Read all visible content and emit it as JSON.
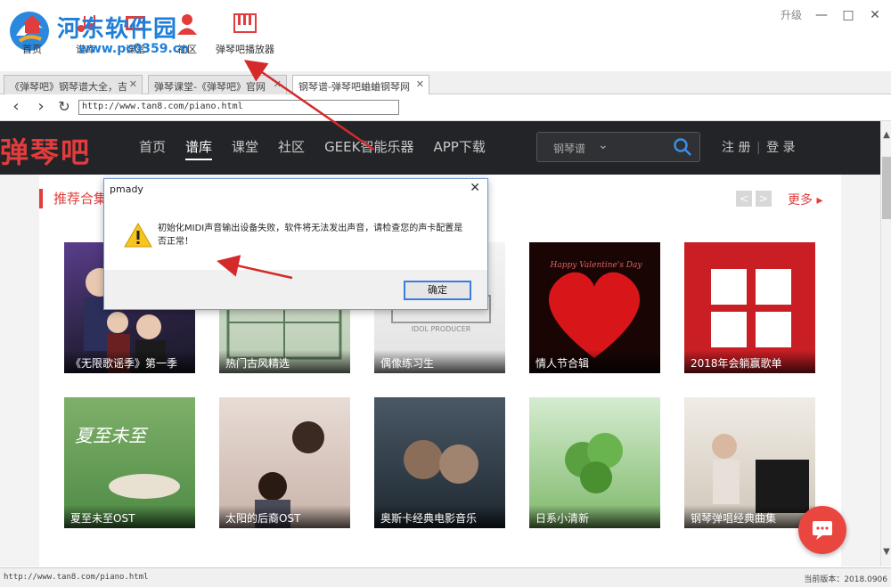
{
  "watermark": {
    "site": "河东软件园",
    "url": "www.pc0359.cn"
  },
  "toolbar": {
    "items": [
      {
        "label": "首页",
        "icon": "home-icon"
      },
      {
        "label": "谱库",
        "icon": "score-icon"
      },
      {
        "label": "课堂",
        "icon": "classroom-icon"
      },
      {
        "label": "社区",
        "icon": "community-icon"
      },
      {
        "label": "弹琴吧播放器",
        "icon": "piano-icon"
      }
    ],
    "upgrade": "升级"
  },
  "tabs": [
    {
      "label": "《弹琴吧》钢琴谱大全，吉"
    },
    {
      "label": "弹琴课堂-《弹琴吧》官网"
    },
    {
      "label": "钢琴谱-弹琴吧蛐蛐钢琴网"
    }
  ],
  "address": {
    "url": "http://www.tan8.com/piano.html"
  },
  "site": {
    "logo": "弹琴吧",
    "nav": [
      "首页",
      "谱库",
      "课堂",
      "社区",
      "GEEK智能乐器",
      "APP下载"
    ],
    "current_nav": "谱库",
    "search_select": "钢琴谱",
    "register": "注 册",
    "login": "登 录",
    "separator": "|"
  },
  "section": {
    "title": "推荐合集",
    "more": "更多",
    "more_arrow": "▸",
    "prev": "<",
    "next": ">"
  },
  "cards": [
    {
      "caption": "《无限歌谣季》第一季"
    },
    {
      "caption": "热门古风精选"
    },
    {
      "caption": "偶像练习生"
    },
    {
      "caption": "情人节合辑"
    },
    {
      "caption": "2018年会躺赢歌单"
    },
    {
      "caption": "夏至未至OST"
    },
    {
      "caption": "太阳的后裔OST"
    },
    {
      "caption": "奥斯卡经典电影音乐"
    },
    {
      "caption": "日系小清新"
    },
    {
      "caption": "钢琴弹唱经典曲集"
    }
  ],
  "dialog": {
    "title": "pmady",
    "message": "初始化MIDI声音输出设备失败，软件将无法发出声音，请检查您的声卡配置是否正常！",
    "ok": "确定"
  },
  "status": {
    "left": "http://www.tan8.com/piano.html",
    "right": "当前版本：2018.0906"
  },
  "colors": {
    "accent": "#e23c3c",
    "header_bg": "#222427",
    "annotation": "#d42a2a"
  }
}
